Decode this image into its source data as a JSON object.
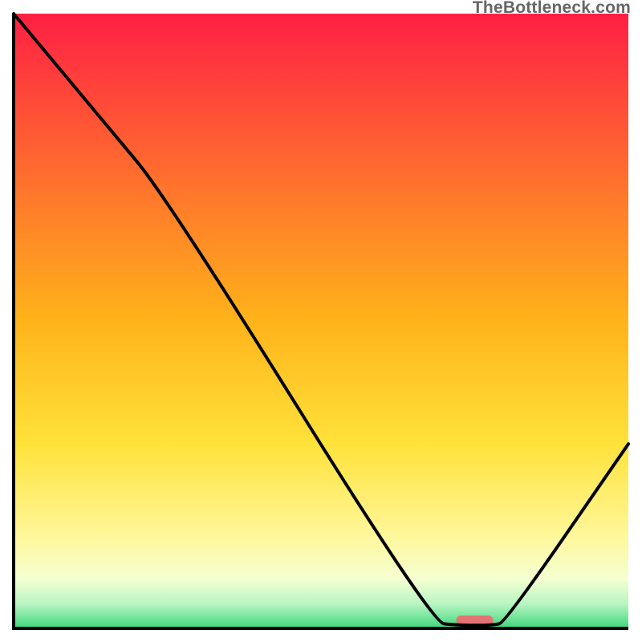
{
  "watermark": "TheBottleneck.com",
  "chart_data": {
    "type": "line",
    "title": "",
    "xlabel": "",
    "ylabel": "",
    "xlim": [
      0,
      100
    ],
    "ylim": [
      0,
      100
    ],
    "series": [
      {
        "name": "curve",
        "x": [
          0,
          15,
          25,
          68,
          72,
          78,
          80,
          100
        ],
        "y": [
          100,
          82,
          70,
          1,
          0.5,
          0.5,
          1,
          30
        ],
        "stroke": "#000000"
      }
    ],
    "marker": {
      "x_center": 75,
      "width": 6,
      "color": "#e57373"
    },
    "gradient_stops": [
      {
        "offset": 0,
        "color": "#ff1f44"
      },
      {
        "offset": 25,
        "color": "#ff6a2f"
      },
      {
        "offset": 50,
        "color": "#ffb31a"
      },
      {
        "offset": 70,
        "color": "#ffe23a"
      },
      {
        "offset": 85,
        "color": "#fff79a"
      },
      {
        "offset": 92,
        "color": "#f4ffd1"
      },
      {
        "offset": 96,
        "color": "#b8f5c2"
      },
      {
        "offset": 100,
        "color": "#3fd77b"
      }
    ],
    "axes": {
      "stroke": "#000000",
      "width": 4
    }
  }
}
